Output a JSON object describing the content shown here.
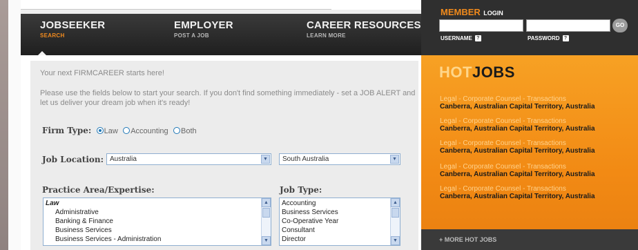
{
  "nav": {
    "items": [
      {
        "title": "JOBSEEKER",
        "sub": "SEARCH"
      },
      {
        "title": "EMPLOYER",
        "sub": "POST A JOB"
      },
      {
        "title": "CAREER RESOURCES",
        "sub": "LEARN MORE"
      }
    ]
  },
  "login": {
    "member": "MEMBER",
    "login": "LOGIN",
    "username_label": "USERNAME",
    "password_label": "PASSWORD",
    "help": "?",
    "go": "GO"
  },
  "search": {
    "intro": "Your next FIRMCAREER starts here!",
    "instructions": "Please use the fields below to start your search. If you don't find something immediately - set a JOB ALERT and let us deliver your dream job when it's ready!",
    "firm_type_label": "Firm Type:",
    "firm_options": [
      "Law",
      "Accounting",
      "Both"
    ],
    "firm_selected": "Law",
    "job_location_label": "Job Location:",
    "country_value": "Australia",
    "state_value": "South Australia",
    "practice_area_label": "Practice Area/Expertise:",
    "practice_area_items": [
      "Law",
      "Administrative",
      "Banking & Finance",
      "Business Services",
      "Business Services - Administration"
    ],
    "job_type_label": "Job Type:",
    "job_type_items": [
      "Accounting",
      "Business Services",
      "Co-Operative Year",
      "Consultant",
      "Director"
    ]
  },
  "hotjobs": {
    "hot": "HOT",
    "jobs": "JOBS",
    "items": [
      {
        "title": "Legal - Corporate Counsel - Transactions",
        "location": "Canberra, Australian Capital Territory, Australia"
      },
      {
        "title": "Legal - Corporate Counsel - Transactions",
        "location": "Canberra, Australian Capital Territory, Australia"
      },
      {
        "title": "Legal - Corporate Counsel - Transactions",
        "location": "Canberra, Australian Capital Territory, Australia"
      },
      {
        "title": "Legal - Corporate Counsel - Transactions",
        "location": "Canberra, Australian Capital Territory, Australia"
      },
      {
        "title": "Legal - Corporate Counsel - Transactions",
        "location": "Canberra, Australian Capital Territory, Australia"
      }
    ],
    "more": "+ MORE HOT JOBS"
  },
  "colors": {
    "accent": "#f28a14",
    "nav_bg": "#2a2a2a",
    "panel_bg": "#ececec"
  }
}
